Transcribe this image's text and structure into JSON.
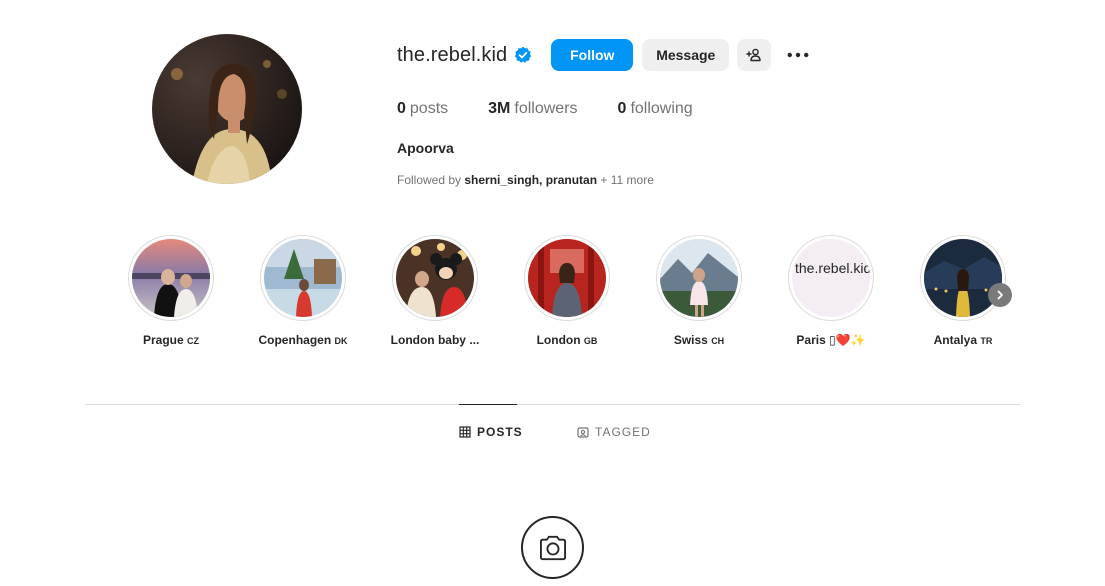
{
  "profile": {
    "username": "the.rebel.kid",
    "follow_label": "Follow",
    "message_label": "Message",
    "stats": {
      "posts_count": "0",
      "posts_label": "posts",
      "followers_count": "3M",
      "followers_label": "followers",
      "following_count": "0",
      "following_label": "following"
    },
    "full_name": "Apoorva",
    "followed_by": {
      "prefix": "Followed by",
      "users": "sherni_singh, pranutan",
      "more": "+ 11 more"
    }
  },
  "highlights": [
    {
      "name": "Prague",
      "code": "CZ"
    },
    {
      "name": "Copenhagen",
      "code": "DK"
    },
    {
      "name": "London baby ...",
      "code": ""
    },
    {
      "name": "London",
      "code": "GB"
    },
    {
      "name": "Swiss",
      "code": "CH"
    },
    {
      "name": "Paris ▯❤️✨",
      "code": "",
      "alt_text": "the.rebel.kid highlight story picture"
    },
    {
      "name": "Antalya",
      "code": "TR"
    }
  ],
  "tabs": {
    "posts_label": "POSTS",
    "tagged_label": "TAGGED"
  },
  "colors": {
    "primary_blue": "#0095f6",
    "secondary_button": "#efefef",
    "muted_text": "#737373"
  },
  "icons": {
    "verified": "verified-badge-icon",
    "add_user": "add-user-icon",
    "more": "more-options-icon",
    "grid": "grid-icon",
    "tagged": "tagged-icon",
    "camera": "camera-icon",
    "next": "chevron-right-icon"
  }
}
